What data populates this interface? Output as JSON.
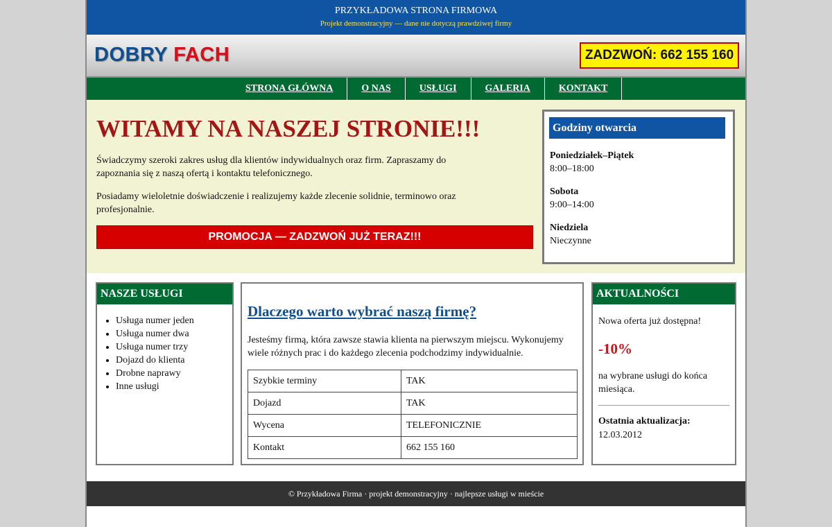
{
  "topbar": {
    "title": "PRZYKŁADOWA STRONA FIRMOWA",
    "subtitle": "Projekt demonstracyjny — dane nie dotyczą prawdziwej firmy"
  },
  "header": {
    "logo_word1": "DOBRY",
    "logo_word2": "FACH",
    "call": "ZADZWOŃ: 662 155 160"
  },
  "nav": {
    "items": [
      "STRONA GŁÓWNA",
      "O NAS",
      "USŁUGI",
      "GALERIA",
      "KONTAKT"
    ]
  },
  "hero": {
    "title": "WITAMY NA NASZEJ STRONIE!!!",
    "paragraph1": "Świadczymy szeroki zakres usług dla klientów indywidualnych oraz firm. Zapraszamy do zapoznania się z naszą ofertą i kontaktu telefonicznego.",
    "paragraph2": "Posiadamy wieloletnie doświadczenie i realizujemy każde zlecenie solidnie, terminowo oraz profesjonalnie.",
    "promo": "PROMOCJA — ZADZWOŃ JUŻ TERAZ!!!"
  },
  "hours": {
    "title": "Godziny otwarcia",
    "rows": [
      {
        "day": "Poniedziałek–Piątek",
        "time": "8:00–18:00"
      },
      {
        "day": "Sobota",
        "time": "9:00–14:00"
      },
      {
        "day": "Niedziela",
        "time": "Nieczynne"
      }
    ]
  },
  "services": {
    "title": "NASZE USŁUGI",
    "items": [
      "Usługa numer jeden",
      "Usługa numer dwa",
      "Usługa numer trzy",
      "Dojazd do klienta",
      "Drobne naprawy",
      "Inne usługi"
    ]
  },
  "why": {
    "title": "Dlaczego warto wybrać naszą firmę?",
    "description": "Jesteśmy firmą, która zawsze stawia klienta na pierwszym miejscu. Wykonujemy wiele różnych prac i do każdego zlecenia podchodzimy indywidualnie.",
    "table": [
      [
        "Szybkie terminy",
        "TAK"
      ],
      [
        "Dojazd",
        "TAK"
      ],
      [
        "Wycena",
        "TELEFONICZNIE"
      ],
      [
        "Kontakt",
        "662 155 160"
      ]
    ]
  },
  "news": {
    "title": "AKTUALNOŚCI",
    "line1": "Nowa oferta już dostępna!",
    "discount": "-10%",
    "line2": "na wybrane usługi do końca miesiąca.",
    "updated_label": "Ostatnia aktualizacja:",
    "updated_date": "12.03.2012"
  },
  "footer": {
    "text": "© Przykładowa Firma · projekt demonstracyjny · najlepsze usługi w mieście"
  },
  "colors": {
    "blue": "#0f55a3",
    "green": "#006a33",
    "red": "#d60000",
    "yellow": "#fff200",
    "hero_bg": "#f1f3d3"
  }
}
